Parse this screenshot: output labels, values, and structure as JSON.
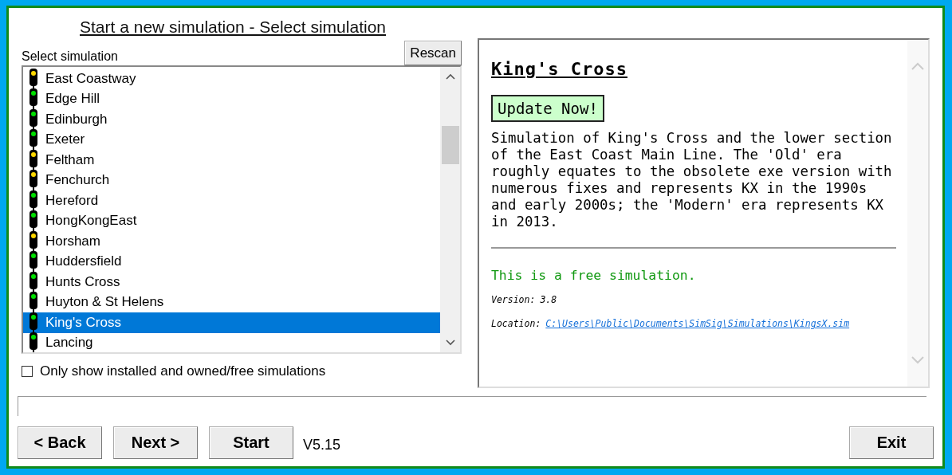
{
  "title": "Start a new simulation - Select simulation",
  "rescan_button": "Rescan",
  "list_label": "Select simulation",
  "simulations": [
    {
      "name": "East Coastway",
      "color": "#ffd800",
      "selected": false
    },
    {
      "name": "Edge Hill",
      "color": "#00e000",
      "selected": false
    },
    {
      "name": "Edinburgh",
      "color": "#00e000",
      "selected": false
    },
    {
      "name": "Exeter",
      "color": "#00e000",
      "selected": false
    },
    {
      "name": "Feltham",
      "color": "#ffd800",
      "selected": false
    },
    {
      "name": "Fenchurch",
      "color": "#ffd800",
      "selected": false
    },
    {
      "name": "Hereford",
      "color": "#00e000",
      "selected": false
    },
    {
      "name": "HongKongEast",
      "color": "#00e000",
      "selected": false
    },
    {
      "name": "Horsham",
      "color": "#ffd800",
      "selected": false
    },
    {
      "name": "Huddersfield",
      "color": "#00e000",
      "selected": false
    },
    {
      "name": "Hunts Cross",
      "color": "#00e000",
      "selected": false
    },
    {
      "name": "Huyton & St Helens",
      "color": "#00e000",
      "selected": false
    },
    {
      "name": "King's Cross",
      "color": "#00e000",
      "selected": true
    },
    {
      "name": "Lancing",
      "color": "#00e000",
      "selected": false
    }
  ],
  "filter_checkbox": {
    "label": "Only show installed and owned/free simulations",
    "checked": false
  },
  "details": {
    "heading": "King's Cross",
    "update_button": "Update Now!",
    "description": "Simulation of King's Cross and the lower section of the East Coast Main Line. The 'Old' era roughly equates to the obsolete exe version with numerous fixes and represents KX in the 1990s and early 2000s; the 'Modern' era represents KX in 2013.",
    "licence": "This is a free simulation.",
    "version_label": "Version:",
    "version": "3.8",
    "location_label": "Location:",
    "location": "C:\\Users\\Public\\Documents\\SimSig\\Simulations\\KingsX.sim"
  },
  "buttons": [
    "< Back",
    "Next >",
    "Start"
  ],
  "version": "V5.15",
  "exit_button": "Exit"
}
